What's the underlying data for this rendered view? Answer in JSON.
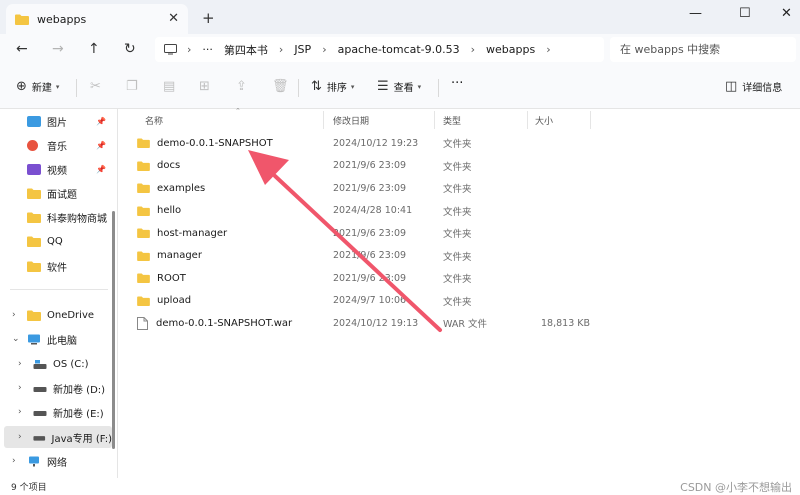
{
  "window": {
    "tab_title": "webapps",
    "tab_close": "✕",
    "tab_add": "+",
    "minimize": "—",
    "maximize": "☐",
    "close": "✕"
  },
  "nav": {
    "back": "←",
    "forward": "→",
    "up": "↑",
    "refresh": "↻",
    "breadcrumb": [
      "第四本书",
      "JSP",
      "apache-tomcat-9.0.53",
      "webapps"
    ],
    "more": "···",
    "sep": "›",
    "search_placeholder": "在 webapps 中搜索"
  },
  "toolbar": {
    "new_label": "新建",
    "sort_label": "排序",
    "view_label": "查看",
    "more": "···",
    "details_label": "详细信息"
  },
  "sidebar": {
    "quick_access": [
      {
        "label": "图片",
        "icon": "image-icon",
        "pinned": true
      },
      {
        "label": "音乐",
        "icon": "music-icon",
        "pinned": true
      },
      {
        "label": "视频",
        "icon": "video-icon",
        "pinned": true
      },
      {
        "label": "面试题",
        "icon": "folder-icon",
        "pinned": false
      },
      {
        "label": "科泰购物商城",
        "icon": "folder-icon",
        "pinned": false
      },
      {
        "label": "QQ",
        "icon": "folder-icon",
        "pinned": false
      },
      {
        "label": "软件",
        "icon": "folder-icon",
        "pinned": false
      }
    ],
    "tree": [
      {
        "label": "OneDrive",
        "icon": "folder-icon",
        "chevron": "›",
        "expanded": false
      },
      {
        "label": "此电脑",
        "icon": "computer-icon",
        "chevron": "⌄",
        "expanded": true
      },
      {
        "label": "OS (C:)",
        "icon": "drive-icon",
        "chevron": "›",
        "expanded": false
      },
      {
        "label": "新加卷 (D:)",
        "icon": "drive-icon",
        "chevron": "›",
        "expanded": false
      },
      {
        "label": "新加卷 (E:)",
        "icon": "drive-icon",
        "chevron": "›",
        "expanded": false
      },
      {
        "label": "Java专用 (F:)",
        "icon": "drive-icon",
        "chevron": "›",
        "expanded": false,
        "selected": true
      },
      {
        "label": "网络",
        "icon": "network-icon",
        "chevron": "›",
        "expanded": false
      }
    ]
  },
  "columns": {
    "name": "名称",
    "modified": "修改日期",
    "type": "类型",
    "size": "大小"
  },
  "files": [
    {
      "name": "demo-0.0.1-SNAPSHOT",
      "modified": "2024/10/12 19:23",
      "type": "文件夹",
      "size": "",
      "kind": "folder"
    },
    {
      "name": "docs",
      "modified": "2021/9/6 23:09",
      "type": "文件夹",
      "size": "",
      "kind": "folder"
    },
    {
      "name": "examples",
      "modified": "2021/9/6 23:09",
      "type": "文件夹",
      "size": "",
      "kind": "folder"
    },
    {
      "name": "hello",
      "modified": "2024/4/28 10:41",
      "type": "文件夹",
      "size": "",
      "kind": "folder"
    },
    {
      "name": "host-manager",
      "modified": "2021/9/6 23:09",
      "type": "文件夹",
      "size": "",
      "kind": "folder"
    },
    {
      "name": "manager",
      "modified": "2021/9/6 23:09",
      "type": "文件夹",
      "size": "",
      "kind": "folder"
    },
    {
      "name": "ROOT",
      "modified": "2021/9/6 23:09",
      "type": "文件夹",
      "size": "",
      "kind": "folder"
    },
    {
      "name": "upload",
      "modified": "2024/9/7 10:06",
      "type": "文件夹",
      "size": "",
      "kind": "folder"
    },
    {
      "name": "demo-0.0.1-SNAPSHOT.war",
      "modified": "2024/10/12 19:13",
      "type": "WAR 文件",
      "size": "18,813 KB",
      "kind": "file"
    }
  ],
  "status": {
    "count": "9 个项目"
  },
  "watermark": "CSDN @小李不想输出",
  "colors": {
    "folder": "#f4c542",
    "arrow": "#f0566b",
    "accent": "#0067c0"
  }
}
